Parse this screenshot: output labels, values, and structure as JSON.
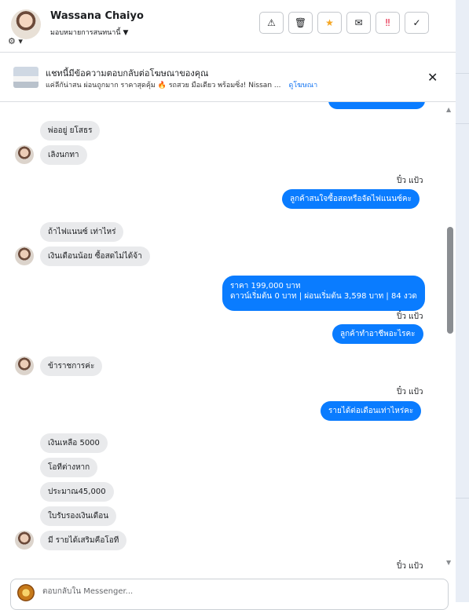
{
  "header": {
    "name": "Wassana Chaiyo",
    "assign_label": "มอบหมายการสนทนานี้",
    "actions": [
      "⚠",
      "🗑",
      "★",
      "✉",
      "‼",
      "✓"
    ]
  },
  "ad": {
    "title": "แชทนี้มีข้อความตอบกลับต่อโฆษณาของคุณ",
    "subtitle": "แค่ลีกัน่าสน ผ่อนถูกมาก ราคาสุดคุ้ม 🔥 รถสวย มือเดียว พร้อมซิ่ง! Nissan ...",
    "link": "ดูโฆษณา"
  },
  "messages": [
    {
      "text": "พ่ออยู่ ยโสธร"
    },
    {
      "text": "เลิงนกทา"
    },
    {
      "text": "ปิ๋ว แป้ว"
    },
    {
      "text": "ลูกค้าสนใจซื้อสดหรือจัดไฟแนนซ์คะ"
    },
    {
      "text": "ถ้าไฟแนนซ์ เท่าไหร่"
    },
    {
      "text": "เงินเดือนน้อย ซื้อสดไม่ได้จ้า"
    },
    {
      "line1": "ราคา 199,000 บาท",
      "line2": "ดาวน์เริ่มต้น 0 บาท | ผ่อนเริ่มต้น 3,598 บาท | 84 งวด"
    },
    {
      "text": "ปิ๋ว แป้ว"
    },
    {
      "text": "ลูกค้าทำอาชีพอะไรคะ"
    },
    {
      "text": "ข้าราชการค่ะ"
    },
    {
      "text": "ปิ๋ว แป้ว"
    },
    {
      "text": "รายได้ต่อเดือนเท่าไหร่คะ"
    },
    {
      "text": "เงินเหลือ 5000"
    },
    {
      "text": "โอทีต่างหาก"
    },
    {
      "text": "ประมาณ45,000"
    },
    {
      "text": "ใบรับรองเงินเดือน"
    },
    {
      "text": "มี รายได้เสริมคือโอที"
    },
    {
      "text": "ปิ๋ว แป้ว"
    }
  ],
  "composer": {
    "placeholder": "ตอบกลับใน Messenger..."
  },
  "colors": {
    "outgoing": "#0a7cff",
    "incoming": "#e9eaec"
  }
}
